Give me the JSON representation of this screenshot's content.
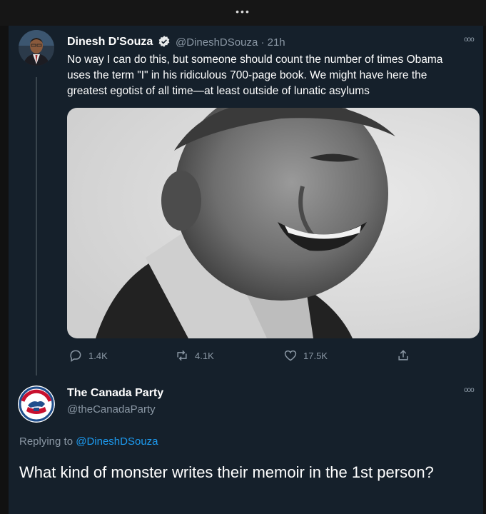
{
  "window": {
    "dots": "•••"
  },
  "tweet": {
    "author_name": "Dinesh D'Souza",
    "verified_icon": "verified-badge-icon",
    "handle_time": "@DineshDSouza · 21h",
    "more": "ooo",
    "text": "No way I can do this, but someone should count the number of times Obama uses the term \"I\" in his ridiculous 700-page book. We might have here the greatest egotist of all time—at least outside of lunatic asylums",
    "actions": {
      "replies": "1.4K",
      "retweets": "4.1K",
      "likes": "17.5K"
    }
  },
  "reply": {
    "author_name": "The Canada Party",
    "handle": "@theCanadaParty",
    "more": "ooo",
    "replying_prefix": "Replying to",
    "replying_to": "@DineshDSouza",
    "text": "What kind of monster writes their memoir in the 1st person?"
  },
  "colors": {
    "background": "#15202b",
    "accent": "#1d9bf0",
    "muted": "#8b98a5"
  }
}
